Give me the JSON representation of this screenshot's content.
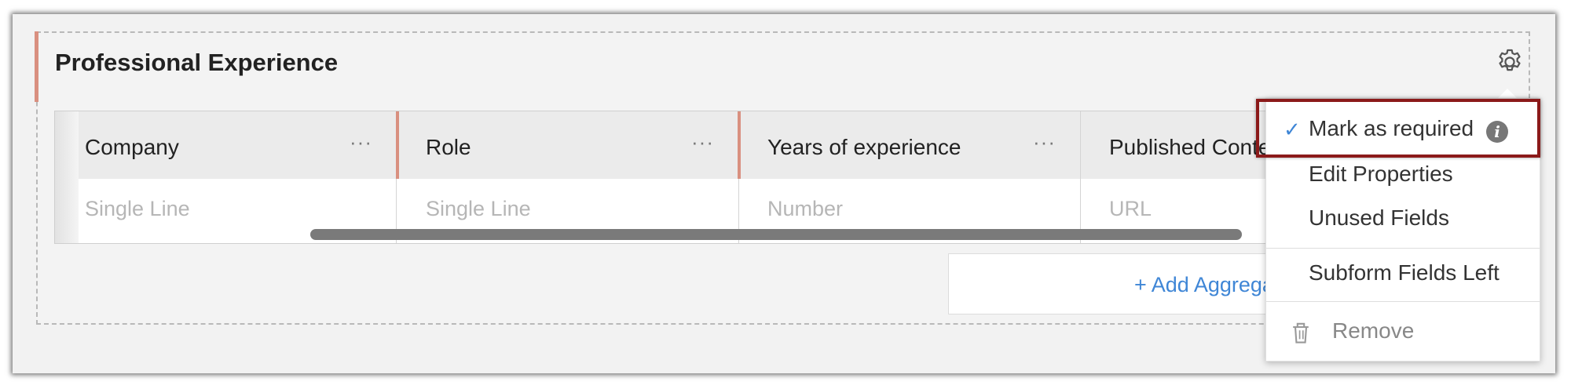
{
  "section": {
    "title": "Professional Experience"
  },
  "table": {
    "columns": [
      {
        "label": "Company",
        "type": "Single Line",
        "more": "···"
      },
      {
        "label": "Role",
        "type": "Single Line",
        "more": "···"
      },
      {
        "label": "Years of experience",
        "type": "Number",
        "more": "···"
      },
      {
        "label": "Published Conte",
        "type": "URL"
      }
    ]
  },
  "add_aggregate": {
    "label": "+ Add Aggrega"
  },
  "menu": {
    "items": [
      {
        "label": "Mark as required",
        "checked": true,
        "info_icon": "info-icon"
      },
      {
        "label": "Edit Properties"
      },
      {
        "label": "Unused Fields"
      },
      {
        "label": "Subform Fields Left"
      },
      {
        "label": "Remove",
        "icon": "trash-icon"
      }
    ]
  },
  "icons": {
    "settings": "gear-icon",
    "check": "check-icon",
    "info": "i"
  },
  "colors": {
    "accent": "#d99080",
    "link": "#3f86d6",
    "highlight_border": "#8b1a1a"
  }
}
